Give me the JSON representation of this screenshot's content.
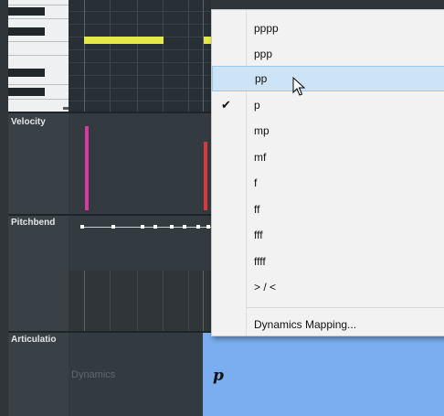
{
  "lanes": {
    "velocity_label": "Velocity",
    "pitchbend_label": "Pitchbend",
    "articulation_label": "Articulatio",
    "dynamics_label": "Dynamics",
    "dynamics_value": "p"
  },
  "dynamics_menu": {
    "items": [
      "pppp",
      "ppp",
      "pp",
      "p",
      "mp",
      "mf",
      "f",
      "ff",
      "fff",
      "ffff",
      "> / <"
    ],
    "highlighted": "pp",
    "checked": "p",
    "mapping_label": "Dynamics Mapping..."
  },
  "colors": {
    "note": "#e6e84a",
    "velocity_bar_1": "#d63aa0",
    "velocity_bar_2": "#d83a3a",
    "menu_highlight": "#cde4f7",
    "dynamics_lane": "#7aaef0"
  },
  "icons": {
    "check": "check-icon",
    "cursor": "mouse-pointer-icon"
  }
}
